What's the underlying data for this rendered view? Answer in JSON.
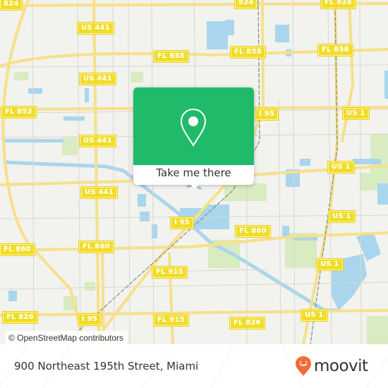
{
  "map": {
    "road_labels": [
      {
        "id": "fl824-a",
        "text": "824"
      },
      {
        "id": "fl824-b",
        "text": "824"
      },
      {
        "id": "fl824-c",
        "text": "FL 824"
      },
      {
        "id": "us441-a",
        "text": "US 441"
      },
      {
        "id": "fl858-a",
        "text": "FL 858"
      },
      {
        "id": "fl858-b",
        "text": "FL 858"
      },
      {
        "id": "fl858-c",
        "text": "FL 858"
      },
      {
        "id": "us441-b",
        "text": "US 441"
      },
      {
        "id": "fl852",
        "text": "FL 852"
      },
      {
        "id": "i95-a",
        "text": "I 95"
      },
      {
        "id": "us1-a",
        "text": "US 1"
      },
      {
        "id": "us441-c",
        "text": "US 441"
      },
      {
        "id": "us1-b",
        "text": "US 1"
      },
      {
        "id": "us441-d",
        "text": "US 441"
      },
      {
        "id": "us1-c",
        "text": "US 1"
      },
      {
        "id": "i95-b",
        "text": "I 95"
      },
      {
        "id": "fl860-a",
        "text": "FL 860"
      },
      {
        "id": "fl860-b",
        "text": "FL 860"
      },
      {
        "id": "fl860-c",
        "text": "FL 860"
      },
      {
        "id": "fl915-a",
        "text": "FL 915"
      },
      {
        "id": "us1-d",
        "text": "US 1"
      },
      {
        "id": "us1-e",
        "text": "US 1"
      },
      {
        "id": "fl826-a",
        "text": "FL 826"
      },
      {
        "id": "i95-c",
        "text": "I 95"
      },
      {
        "id": "fl915-b",
        "text": "FL 915"
      },
      {
        "id": "fl826-b",
        "text": "FL 826"
      }
    ],
    "attribution": "© OpenStreetMap contributors"
  },
  "popup": {
    "icon": "map-pin-icon",
    "cta_label": "Take me there",
    "color": "#1fba6a"
  },
  "footer": {
    "address": "900 Northeast 195th Street, Miami",
    "brand": "moovit",
    "brand_color": "#f26b3a"
  }
}
